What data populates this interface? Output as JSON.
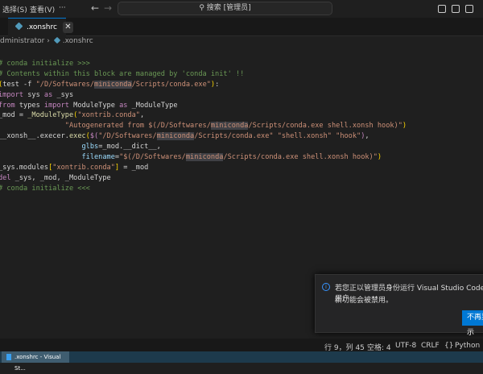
{
  "titlebar": {
    "menu": [
      "选择(S)",
      "查看(V)",
      "···"
    ],
    "back": "←",
    "forward": "→",
    "search": "搜索 [管理员]"
  },
  "tab": {
    "label": ".xonshrc",
    "close": "✕"
  },
  "breadcrumb": {
    "folder": "dministrator",
    "sep": "›",
    "file": ".xonshrc"
  },
  "code": [
    [
      [
        "# conda initialize >>>",
        "c"
      ]
    ],
    [
      [
        "# Contents within this block are managed by 'conda init' !!",
        "c"
      ]
    ],
    [
      [
        "(",
        "b"
      ],
      [
        "test -f ",
        "d"
      ],
      [
        "\"/D/Softwares/",
        "s"
      ],
      [
        "miniconda",
        "s h"
      ],
      [
        "/Scripts/conda.exe\"",
        "s"
      ],
      [
        ")",
        "b"
      ],
      [
        ":",
        "d"
      ]
    ],
    [
      [
        "import",
        "k"
      ],
      [
        " sys ",
        "d"
      ],
      [
        "as",
        "k"
      ],
      [
        " _sys",
        "d"
      ]
    ],
    [
      [
        "from",
        "k"
      ],
      [
        " types ",
        "d"
      ],
      [
        "import",
        "k"
      ],
      [
        " ModuleType ",
        "d"
      ],
      [
        "as",
        "k"
      ],
      [
        " _ModuleType",
        "d"
      ]
    ],
    [
      [
        "_mod = ",
        "d"
      ],
      [
        "_ModuleType",
        "f"
      ],
      [
        "(",
        "b"
      ],
      [
        "\"xontrib.conda\"",
        "s"
      ],
      [
        ",",
        "d"
      ]
    ],
    [
      [
        "                ",
        "d"
      ],
      [
        "\"Autogenerated from $(/D/Softwares/",
        "s"
      ],
      [
        "miniconda",
        "s h"
      ],
      [
        "/Scripts/conda.exe shell.xonsh hook)\"",
        "s"
      ],
      [
        ")",
        "b"
      ]
    ],
    [
      [
        "__xonsh__.execer.",
        "d"
      ],
      [
        "exec",
        "f"
      ],
      [
        "(",
        "b"
      ],
      [
        "$(",
        "k"
      ],
      [
        "\"/D/Softwares/",
        "s"
      ],
      [
        "miniconda",
        "s h"
      ],
      [
        "/Scripts/conda.exe\" \"shell.xonsh\" \"hook\"",
        "s"
      ],
      [
        ")",
        "k"
      ],
      [
        ",",
        "d"
      ]
    ],
    [
      [
        "                    ",
        "d"
      ],
      [
        "glbs",
        "v"
      ],
      [
        "=_mod.__dict__,",
        "d"
      ]
    ],
    [
      [
        "                    ",
        "d"
      ],
      [
        "filename",
        "v"
      ],
      [
        "=",
        "d"
      ],
      [
        "\"$(/D/Softwares/",
        "s"
      ],
      [
        "miniconda",
        "s h"
      ],
      [
        "/Scripts/conda.exe shell.xonsh hook)\"",
        "s"
      ],
      [
        ")",
        "b"
      ]
    ],
    [
      [
        "_sys.modules",
        "d"
      ],
      [
        "[",
        "b"
      ],
      [
        "\"xontrib.conda\"",
        "s"
      ],
      [
        "]",
        "b"
      ],
      [
        " = _mod",
        "d"
      ]
    ],
    [
      [
        "del",
        "k"
      ],
      [
        " _sys, _mod, _ModuleType",
        "d"
      ]
    ],
    [
      [
        "# conda initialize <<<",
        "c"
      ]
    ]
  ],
  "notification": {
    "message_line1": "若您正以管理员身份运行 Visual Studio Code 用户",
    "message_line2": "新功能会被禁用。",
    "button": "不再显示"
  },
  "status": {
    "position": "行 9，列 45",
    "indent": "空格: 4",
    "encoding": "UTF-8",
    "eol": "CRLF",
    "language": "Python"
  },
  "taskbar": {
    "item": ".xonshrc - Visual St..."
  },
  "colors": {
    "accent": "#0078d4",
    "comment": "#6a9955",
    "keyword": "#c586c0",
    "string": "#ce9178"
  }
}
